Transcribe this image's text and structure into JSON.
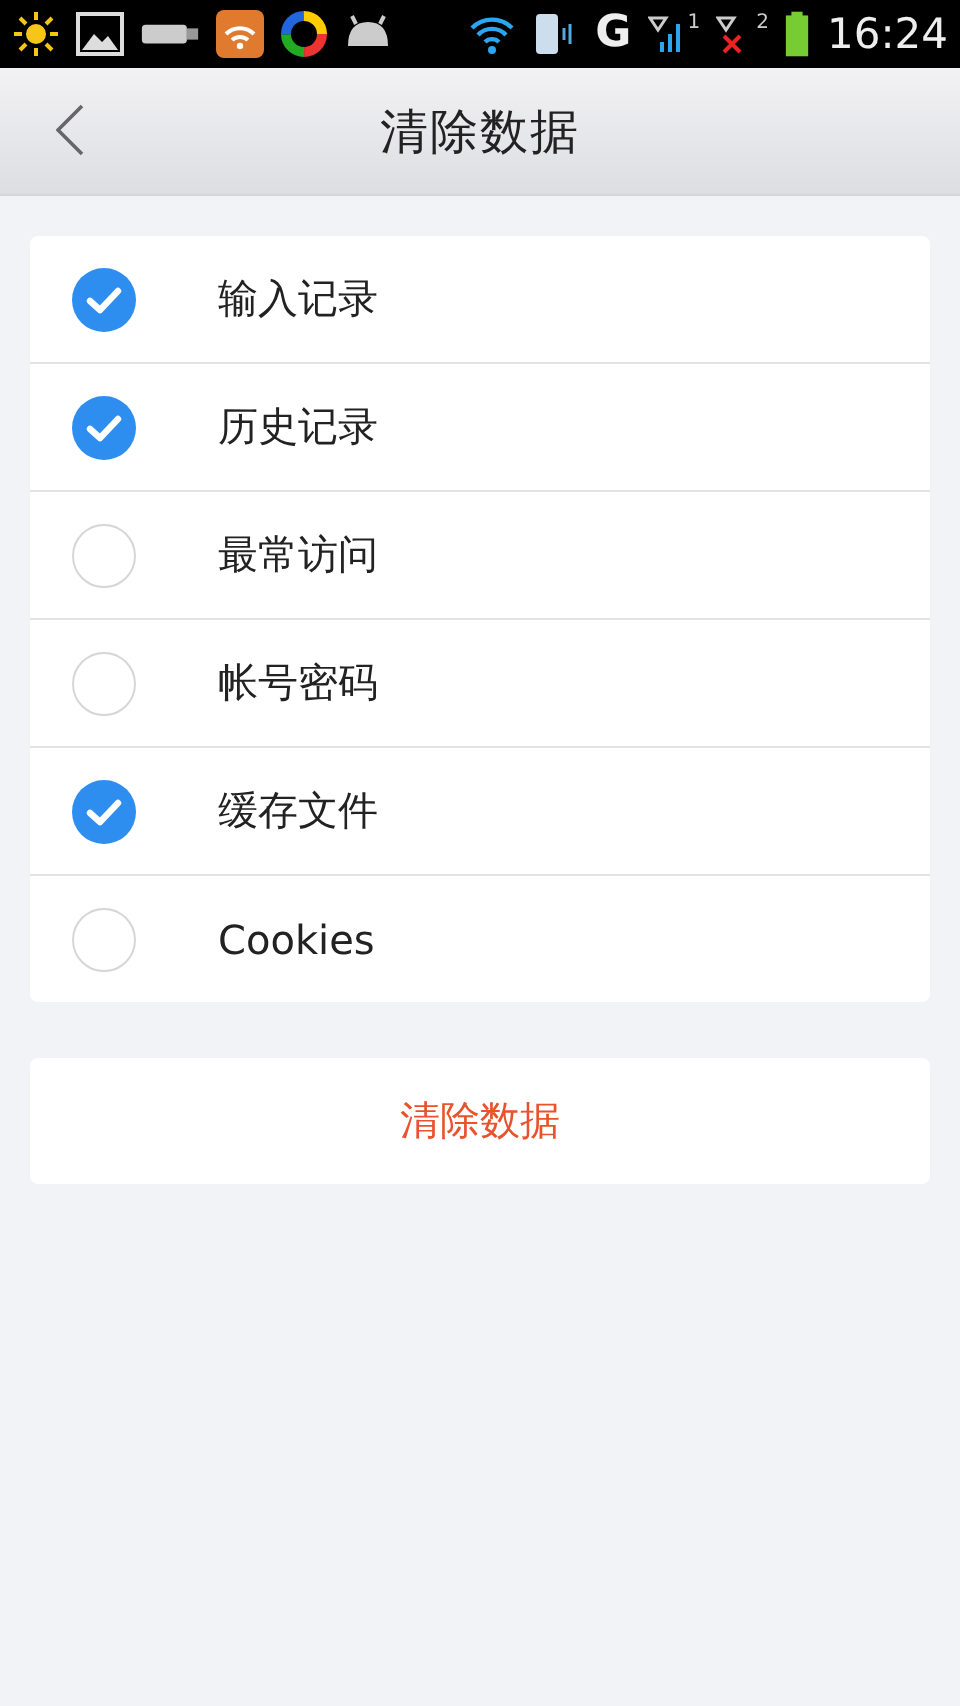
{
  "status_bar": {
    "network": "G",
    "sim_1": "1",
    "sim_2": "2",
    "time": "16:24"
  },
  "header": {
    "title": "清除数据"
  },
  "options": [
    {
      "label": "输入记录",
      "checked": true
    },
    {
      "label": "历史记录",
      "checked": true
    },
    {
      "label": "最常访问",
      "checked": false
    },
    {
      "label": "帐号密码",
      "checked": false
    },
    {
      "label": "缓存文件",
      "checked": true
    },
    {
      "label": "Cookies",
      "checked": false
    }
  ],
  "action_button": "清除数据"
}
